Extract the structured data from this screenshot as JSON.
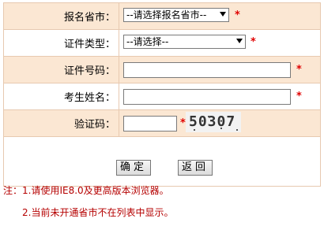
{
  "form": {
    "province": {
      "label": "报名省市：",
      "value": "--请选择报名省市--"
    },
    "id_type": {
      "label": "证件类型：",
      "value": "--请选择--"
    },
    "id_number": {
      "label": "证件号码：",
      "value": ""
    },
    "name": {
      "label": "考生姓名：",
      "value": ""
    },
    "captcha": {
      "label": "验证码：",
      "value": "",
      "image_text": "50307"
    },
    "required_mark": "*"
  },
  "buttons": {
    "confirm": "确定",
    "back": "返回"
  },
  "notes": {
    "line1": "注：1.请使用IE8.0及更高版本浏览器。",
    "line2": "2.当前未开通省市不在列表中显示。"
  },
  "colors": {
    "label_bg": "#fbe7d3",
    "border": "#e7c9b0",
    "required": "#e00000",
    "note": "#b50000"
  }
}
